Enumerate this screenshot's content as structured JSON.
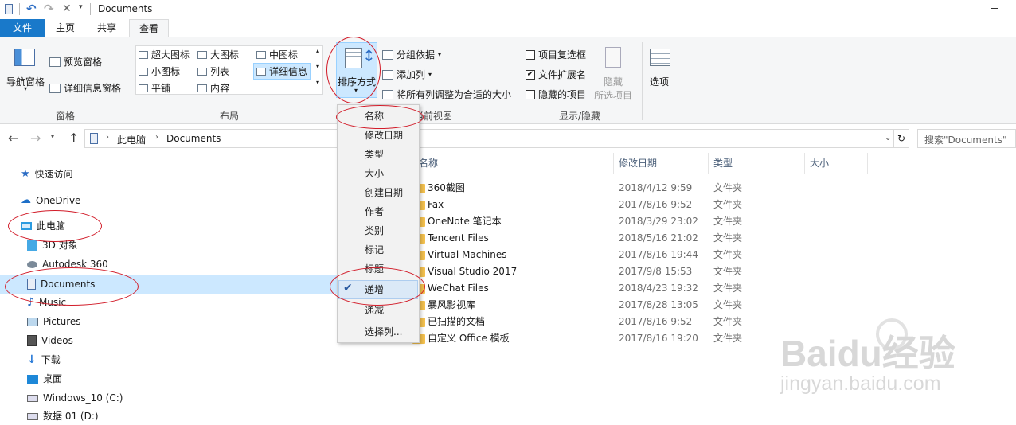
{
  "window": {
    "title": "Documents"
  },
  "ribbon_tabs": {
    "file": "文件",
    "home": "主页",
    "share": "共享",
    "view": "查看"
  },
  "panes": {
    "nav_pane": "导航窗格",
    "preview_pane": "预览窗格",
    "details_pane": "详细信息窗格",
    "group_label": "窗格"
  },
  "layout": {
    "extra_large": "超大图标",
    "large": "大图标",
    "medium": "中图标",
    "small": "小图标",
    "list": "列表",
    "details": "详细信息",
    "tiles": "平铺",
    "content": "内容",
    "group_label": "布局"
  },
  "current_view": {
    "sort_by": "排序方式",
    "group_by": "分组依据",
    "add_columns": "添加列",
    "size_all": "将所有列调整为合适的大小",
    "group_label": "当前视图"
  },
  "show_hide": {
    "item_checkboxes": "项目复选框",
    "file_extensions": "文件扩展名",
    "hidden_items": "隐藏的项目",
    "hide": "隐藏",
    "hide_selected": "所选项目",
    "options": "选项",
    "group_label": "显示/隐藏",
    "item_checkboxes_checked": false,
    "file_extensions_checked": true,
    "hidden_items_checked": false
  },
  "address": {
    "path": [
      "此电脑",
      "Documents"
    ],
    "search_placeholder": "搜索\"Documents\""
  },
  "nav": {
    "quick_access": "快速访问",
    "onedrive": "OneDrive",
    "this_pc": "此电脑",
    "items": [
      "3D 对象",
      "Autodesk 360",
      "Documents",
      "Music",
      "Pictures",
      "Videos",
      "下载",
      "桌面",
      "Windows_10 (C:)",
      "数据 01 (D:)"
    ]
  },
  "columns": {
    "name": "名称",
    "date": "修改日期",
    "type": "类型",
    "size": "大小"
  },
  "files": [
    {
      "name": "360截图",
      "date": "2018/4/12 9:59",
      "type": "文件夹"
    },
    {
      "name": "Fax",
      "date": "2017/8/16 9:52",
      "type": "文件夹"
    },
    {
      "name": "OneNote 笔记本",
      "date": "2018/3/29 23:02",
      "type": "文件夹"
    },
    {
      "name": "Tencent Files",
      "date": "2018/5/16 21:02",
      "type": "文件夹"
    },
    {
      "name": "Virtual Machines",
      "date": "2017/8/16 19:44",
      "type": "文件夹"
    },
    {
      "name": "Visual Studio 2017",
      "date": "2017/9/8 15:53",
      "type": "文件夹"
    },
    {
      "name": "WeChat Files",
      "date": "2018/4/23 19:32",
      "type": "文件夹"
    },
    {
      "name": "暴风影视库",
      "date": "2017/8/28 13:05",
      "type": "文件夹"
    },
    {
      "name": "已扫描的文档",
      "date": "2017/8/16 9:52",
      "type": "文件夹"
    },
    {
      "name": "自定义 Office 模板",
      "date": "2017/8/16 19:20",
      "type": "文件夹"
    }
  ],
  "sort_menu": {
    "items": [
      "名称",
      "修改日期",
      "类型",
      "大小",
      "创建日期",
      "作者",
      "类别",
      "标记",
      "标题"
    ],
    "ascending": "递增",
    "descending": "递减",
    "choose_columns": "选择列...",
    "ascending_checked": true
  },
  "watermark": {
    "brand": "Baidu经验",
    "url": "jingyan.baidu.com"
  },
  "colors": {
    "accent": "#1979ca",
    "annotation": "#d21d2a",
    "selected_nav": "#cce8ff",
    "folder": "#f4c14e"
  }
}
